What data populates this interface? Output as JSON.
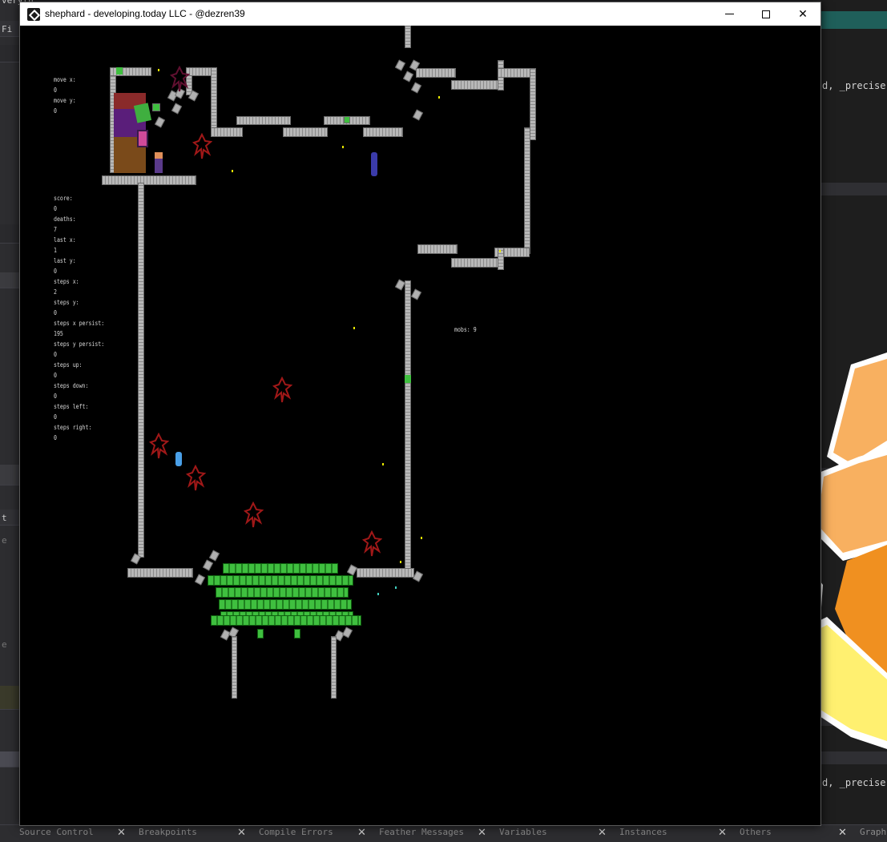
{
  "ide": {
    "left_fragments": [
      "veryth",
      "Fi",
      "t",
      "e",
      "e"
    ],
    "right_code_lines": [
      "d, _precise,",
      "d, _precise,"
    ],
    "bottom_tabs": [
      {
        "label": "Source Control"
      },
      {
        "label": "Breakpoints"
      },
      {
        "label": "Compile Errors"
      },
      {
        "label": "Feather Messages"
      },
      {
        "label": "Variables"
      },
      {
        "label": "Instances"
      },
      {
        "label": "Others"
      },
      {
        "label": "Graph"
      }
    ],
    "close_glyph": "✕"
  },
  "window": {
    "title": "shephard - developing.today LLC - @dezren39",
    "icon": "gamemaker-icon",
    "controls": {
      "minimize": "minimize-icon",
      "maximize": "maximize-icon",
      "close": "✕"
    }
  },
  "hud": {
    "move_x_label": "move x:",
    "move_x_value": "0",
    "move_y_label": "move y:",
    "move_y_value": "0",
    "score_label": "score:",
    "score_value": "0",
    "deaths_label": "deaths:",
    "deaths_value": "7",
    "last_x_label": "last x:",
    "last_x_value": "1",
    "last_y_label": "last y:",
    "last_y_value": "0",
    "steps_x_label": "steps x:",
    "steps_x_value": "2",
    "steps_y_label": "steps y:",
    "steps_y_value": "0",
    "steps_x_persist_label": "steps x persist:",
    "steps_x_persist_value": "195",
    "steps_y_persist_label": "steps y persist:",
    "steps_y_persist_value": "0",
    "steps_up_label": "steps up:",
    "steps_up_value": "0",
    "steps_down_label": "steps down:",
    "steps_down_value": "0",
    "steps_left_label": "steps left:",
    "steps_left_value": "0",
    "steps_right_label": "steps right:",
    "steps_right_value": "0",
    "mobs_label": "mobs: 9"
  },
  "colors": {
    "tile": "#b8b8b8",
    "grass": "#3fbf3f",
    "monster": "#a01818",
    "orange_light": "#f8b060",
    "orange": "#f09020",
    "red_orange": "#f07050",
    "yellow": "#fff070"
  }
}
